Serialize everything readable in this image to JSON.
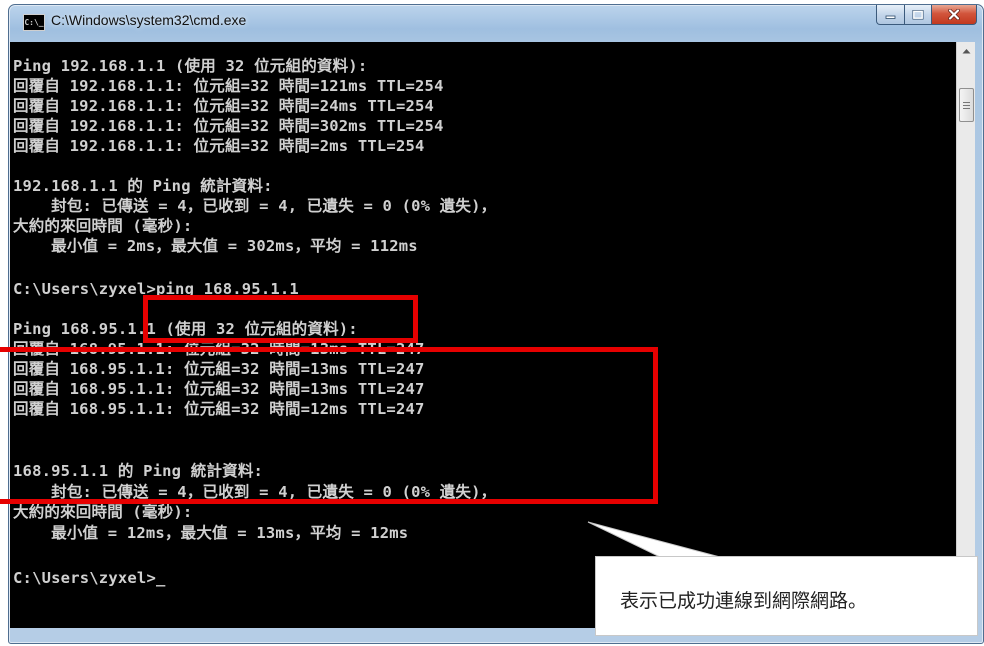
{
  "window": {
    "title": "C:\\Windows\\system32\\cmd.exe",
    "icon_label": "C:\\_",
    "icon": "cmd-icon",
    "buttons": {
      "minimize": "minimize-icon",
      "maximize": "maximize-icon",
      "close": "close-icon"
    }
  },
  "console": {
    "lines": [
      "Ping 192.168.1.1 (使用 32 位元組的資料):",
      "回覆自 192.168.1.1: 位元組=32 時間=121ms TTL=254",
      "回覆自 192.168.1.1: 位元組=32 時間=24ms TTL=254",
      "回覆自 192.168.1.1: 位元組=32 時間=302ms TTL=254",
      "回覆自 192.168.1.1: 位元組=32 時間=2ms TTL=254",
      "",
      "192.168.1.1 的 Ping 統計資料:",
      "    封包: 已傳送 = 4，已收到 = 4, 已遺失 = 0 (0% 遺失)，",
      "大約的來回時間 (毫秒):",
      "    最小值 = 2ms，最大值 = 302ms，平均 = 112ms",
      "",
      "C:\\Users\\zyxel>ping 168.95.1.1",
      "",
      "Ping 168.95.1.1 (使用 32 位元組的資料):",
      "回覆自 168.95.1.1: 位元組=32 時間=13ms TTL=247",
      "回覆自 168.95.1.1: 位元組=32 時間=13ms TTL=247",
      "回覆自 168.95.1.1: 位元組=32 時間=13ms TTL=247",
      "回覆自 168.95.1.1: 位元組=32 時間=12ms TTL=247",
      "",
      "168.95.1.1 的 Ping 統計資料:",
      "    封包: 已傳送 = 4，已收到 = 4, 已遺失 = 0 (0% 遺失)，",
      "大約的來回時間 (毫秒):",
      "    最小值 = 12ms，最大值 = 13ms，平均 = 12ms",
      "",
      "C:\\Users\\zyxel>_"
    ]
  },
  "annotation": {
    "callout_text": "表示已成功連線到網際網路。",
    "highlight_color": "#e60000"
  },
  "colors": {
    "console_bg": "#000000",
    "console_text": "#d0d0d0"
  }
}
